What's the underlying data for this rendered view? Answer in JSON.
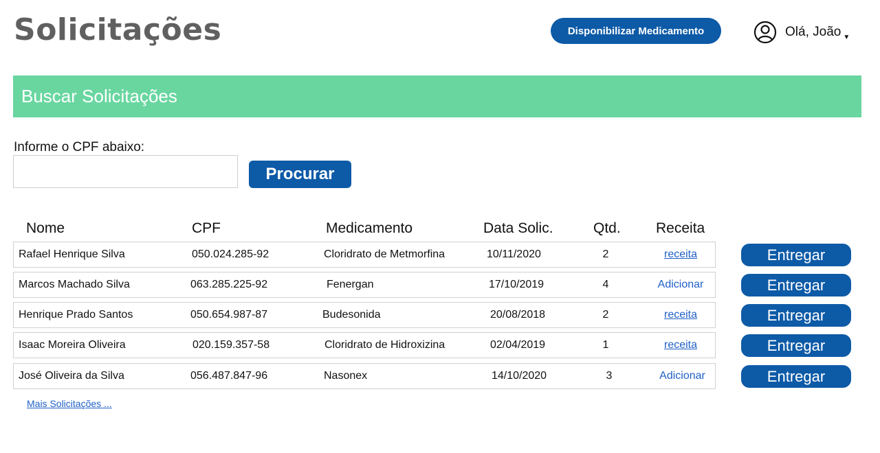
{
  "header": {
    "title": "Solicitações",
    "action_button": "Disponibilizar Medicamento",
    "user_greeting": "Olá, João"
  },
  "search": {
    "banner_title": "Buscar Solicitações",
    "cpf_label": "Informe o CPF abaixo:",
    "cpf_value": "",
    "cpf_placeholder": "",
    "button_label": "Procurar"
  },
  "table": {
    "columns": [
      "Nome",
      "CPF",
      "Medicamento",
      "Data Solic.",
      "Qtd.",
      "Receita"
    ],
    "rows": [
      {
        "nome": "Rafael Henrique Silva",
        "cpf": "050.024.285-92",
        "medicamento": "Cloridrato de Metmorfina",
        "data": "10/11/2020",
        "qtd": "2",
        "receita": "receita",
        "receita_type": "view"
      },
      {
        "nome": "Marcos Machado Silva",
        "cpf": "063.285.225-92",
        "medicamento": "Fenergan",
        "data": "17/10/2019",
        "qtd": "4",
        "receita": "Adicionar",
        "receita_type": "add"
      },
      {
        "nome": "Henrique Prado Santos",
        "cpf": "050.654.987-87",
        "medicamento": "Budesonida",
        "data": "20/08/2018",
        "qtd": "2",
        "receita": "receita",
        "receita_type": "view"
      },
      {
        "nome": "Isaac Moreira Oliveira",
        "cpf": "020.159.357-58",
        "medicamento": "Cloridrato de Hidroxizina",
        "data": "02/04/2019",
        "qtd": "1",
        "receita": "receita",
        "receita_type": "view"
      },
      {
        "nome": "José Oliveira da Silva",
        "cpf": "056.487.847-96",
        "medicamento": "Nasonex",
        "data": "14/10/2020",
        "qtd": "3",
        "receita": "Adicionar",
        "receita_type": "add"
      }
    ],
    "row_action_label": "Entregar",
    "more_link": "Mais Solicitações ..."
  },
  "icons": {
    "user": "user-circle-icon",
    "dropdown": "caret-down-icon"
  },
  "colors": {
    "primary": "#0d5aa7",
    "banner": "#69d6a0",
    "title_gray": "#606060",
    "link": "#1f5fc6"
  }
}
